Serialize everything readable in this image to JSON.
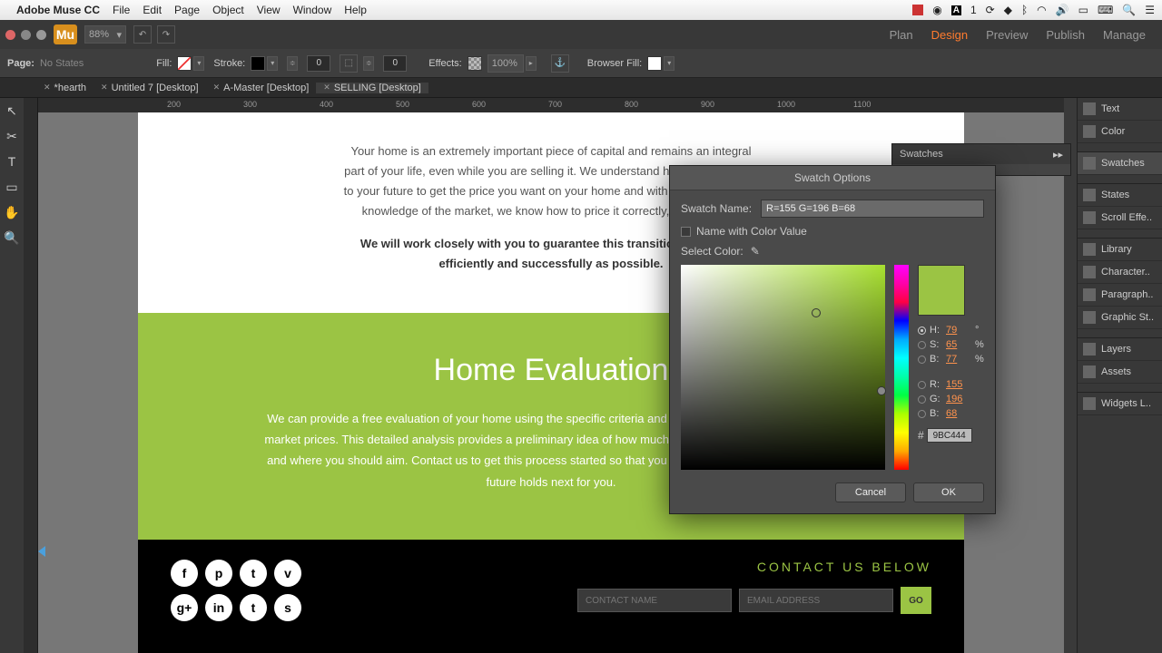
{
  "mac": {
    "app": "Adobe Muse CC",
    "menus": [
      "File",
      "Edit",
      "Page",
      "Object",
      "View",
      "Window",
      "Help"
    ],
    "right_badge": "1"
  },
  "header": {
    "zoom": "88%",
    "tabs": [
      "Plan",
      "Design",
      "Preview",
      "Publish",
      "Manage"
    ],
    "active": 1
  },
  "optbar": {
    "page_label": "Page:",
    "page_state": "No States",
    "fill_label": "Fill:",
    "stroke_label": "Stroke:",
    "stroke_val": "0",
    "corner_val": "0",
    "effects_label": "Effects:",
    "effects_pct": "100%",
    "browserfill_label": "Browser Fill:"
  },
  "doctabs": [
    {
      "label": "*hearth",
      "close": true
    },
    {
      "label": "Untitled 7 [Desktop]",
      "close": true
    },
    {
      "label": "A-Master [Desktop]",
      "close": true
    },
    {
      "label": "SELLING [Desktop]",
      "close": true,
      "active": true
    }
  ],
  "ruler": {
    "h": [
      "200",
      "300",
      "400",
      "500",
      "600",
      "700",
      "800",
      "900",
      "1000",
      "1100"
    ]
  },
  "canvas": {
    "p1": "Your home is an extremely important piece of capital and remains an integral part of your life, even while you are selling it. We understand how important it is to your future to get the price you want on your home and with our considerable knowledge of the market, we know how to price it correctly, the first time.",
    "p2": "We will work closely with you to guarantee this transition is done as efficiently and successfully as possible.",
    "h2": "Home Evaluation",
    "p3": "We can provide a free evaluation of your home using the specific criteria and compare it with relevant current market prices. This detailed analysis provides a preliminary idea of how much you can expect from the market and where you should aim. Contact us to get this process started so that you can move forward and what the future holds next for you.",
    "contact_title": "CONTACT US BELOW",
    "name_ph": "CONTACT NAME",
    "email_ph": "EMAIL ADDRESS",
    "go": "GO",
    "social": [
      "f",
      "p",
      "t",
      "v",
      "g+",
      "in",
      "t",
      "s"
    ]
  },
  "swatches_panel": {
    "title": "Swatches"
  },
  "rbar": {
    "items": [
      "Text",
      "Color",
      "Swatches",
      "States",
      "Scroll Effe..",
      "Library",
      "Character..",
      "Paragraph..",
      "Graphic St..",
      "Layers",
      "Assets",
      "Widgets L.."
    ],
    "active": 2
  },
  "dialog": {
    "title": "Swatch Options",
    "name_label": "Swatch Name:",
    "name_value": "R=155 G=196 B=68",
    "name_with_value": "Name with Color Value",
    "select_color": "Select Color:",
    "hsb": {
      "H": "79",
      "S": "65",
      "B": "77"
    },
    "rgb": {
      "R": "155",
      "G": "196",
      "B": "68"
    },
    "hex": "9BC444",
    "cancel": "Cancel",
    "ok": "OK"
  }
}
